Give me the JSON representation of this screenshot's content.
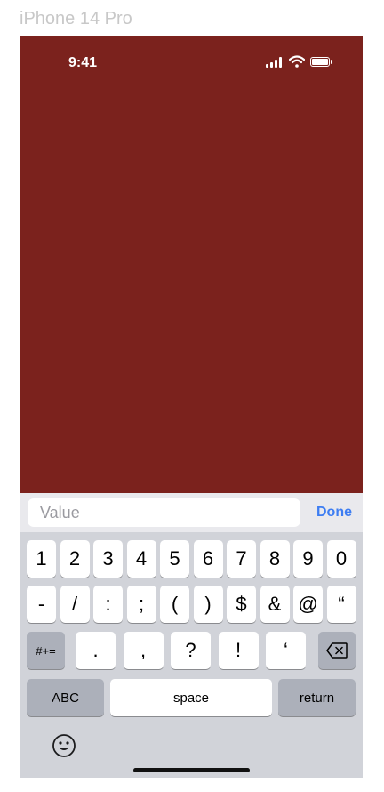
{
  "device": {
    "label": "iPhone 14 Pro"
  },
  "status_bar": {
    "time": "9:41",
    "icons": [
      "signal-icon",
      "wifi-icon",
      "battery-icon"
    ]
  },
  "colors": {
    "screen_background": "#7b221d",
    "accent": "#3d7df2",
    "keyboard_background": "#d1d3d9"
  },
  "input": {
    "placeholder": "Value",
    "value": ""
  },
  "accessory": {
    "done_label": "Done"
  },
  "keyboard": {
    "row1": [
      "1",
      "2",
      "3",
      "4",
      "5",
      "6",
      "7",
      "8",
      "9",
      "0"
    ],
    "row2": [
      "-",
      "/",
      ":",
      ";",
      "(",
      ")",
      "$",
      "&",
      "@",
      "“"
    ],
    "row3": [
      ".",
      ",",
      "?",
      "!",
      "‘"
    ],
    "mode_symbols_label": "#+=",
    "delete_icon": "delete-icon",
    "abc_label": "ABC",
    "space_label": "space",
    "return_label": "return",
    "emoji_icon": "emoji-icon"
  }
}
